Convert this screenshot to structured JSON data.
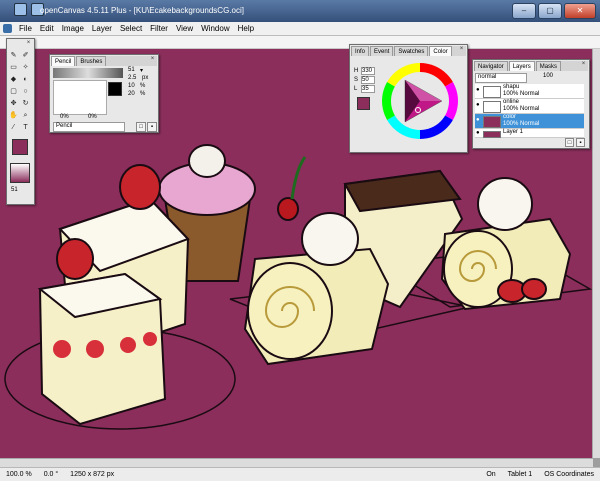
{
  "window": {
    "title": "openCanvas 4.5.11 Plus - [KU\\EcakebackgroundsCG.oci]"
  },
  "menu": [
    "File",
    "Edit",
    "Image",
    "Layer",
    "Select",
    "Filter",
    "View",
    "Window",
    "Help"
  ],
  "tool_panel": {
    "brush_size": "51",
    "color_main": "#8b2e5c"
  },
  "brush_panel": {
    "tabs": [
      "Pencil",
      "Brushes"
    ],
    "fields": [
      {
        "value": "51",
        "unit": "▾"
      },
      {
        "value": "2.5",
        "unit": "px"
      },
      {
        "value": "10",
        "unit": "%"
      },
      {
        "value": "20",
        "unit": "%"
      }
    ],
    "opacity_left": "0%",
    "opacity_right": "0%",
    "tool_name": "Pencil"
  },
  "color_panel": {
    "tabs": [
      "Info",
      "Event",
      "Swatches",
      "Color"
    ],
    "hsv": [
      {
        "label": "H",
        "value": "330"
      },
      {
        "label": "S",
        "value": "50"
      },
      {
        "label": "L",
        "value": "35"
      }
    ],
    "current_color": "#8b2e5c"
  },
  "layers_panel": {
    "tabs": [
      "Navigator",
      "Layers",
      "Masks"
    ],
    "blend_mode": "normal",
    "opacity": "100",
    "layers": [
      {
        "name": "shapu",
        "mode": "100% Normal",
        "selected": false
      },
      {
        "name": "online",
        "mode": "100% Normal",
        "selected": false
      },
      {
        "name": "color",
        "mode": "100% Normal",
        "selected": true
      },
      {
        "name": "Layer 1",
        "mode": "",
        "selected": false
      }
    ]
  },
  "status": {
    "zoom": "100.0 %",
    "angle": "0.0 °",
    "size": "1250 x 872 px",
    "state": "On",
    "tablet": "Tablet 1",
    "coords": "OS Coordinates"
  }
}
